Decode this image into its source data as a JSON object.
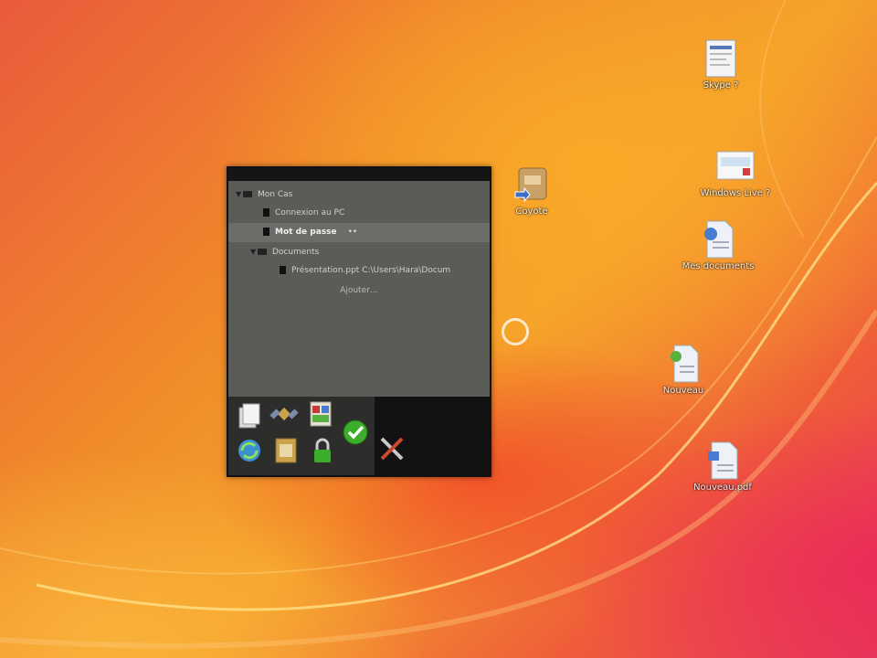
{
  "desktop": {
    "icons": [
      {
        "label": "Skype ?",
        "icon": "document-icon"
      },
      {
        "label": "Windows Live ?",
        "icon": "image-file-icon"
      },
      {
        "label": "Mes documents",
        "icon": "word-document-icon"
      },
      {
        "label": "Nouveau",
        "icon": "text-file-icon"
      },
      {
        "label": "Nouveau.pdf",
        "icon": "file-icon"
      },
      {
        "label": "Coyote",
        "icon": "shortcut-app-icon"
      }
    ]
  },
  "widget": {
    "tree": [
      {
        "type": "folder",
        "label": "Mon Cas"
      },
      {
        "type": "item",
        "label": "Connexion au PC"
      },
      {
        "type": "item",
        "label": "Mot de passe",
        "extra": "••",
        "selected": true
      },
      {
        "type": "folder",
        "label": "Documents"
      },
      {
        "type": "item",
        "label": "Présentation.ppt    C:\\Users\\Hara\\Docum"
      }
    ],
    "add_label": "Ajouter…",
    "toolbar": [
      "new-page-icon",
      "satellite-icon",
      "blocked-list-icon",
      "sync-icon",
      "database-icon",
      "lock-icon",
      "check-icon",
      "settings-tools-icon"
    ]
  },
  "colors": {
    "widget_bg": "#5a5c58",
    "toolbar_bg": "#121212",
    "accent_green": "#3dae2b"
  }
}
